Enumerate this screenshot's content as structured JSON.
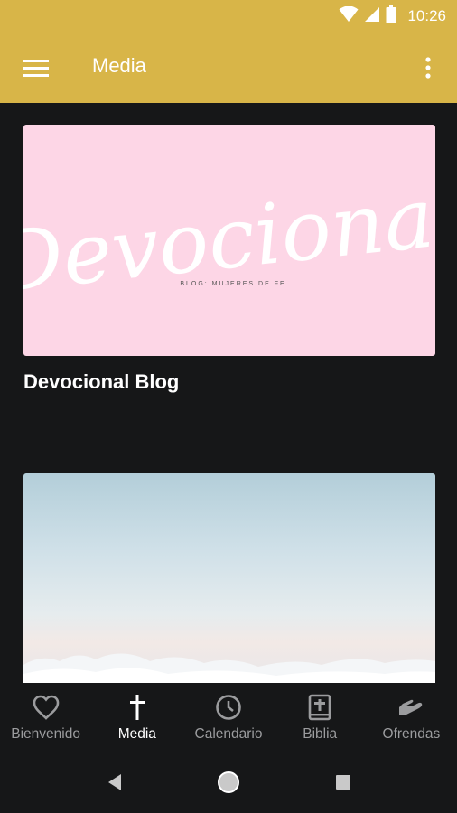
{
  "status_bar": {
    "time": "10:26",
    "icons": [
      "wifi-icon",
      "cell-signal-icon",
      "battery-icon"
    ]
  },
  "app_bar": {
    "title": "Media",
    "menu_icon": "hamburger-menu-icon",
    "overflow_icon": "more-vertical-icon",
    "color": "#d8b548"
  },
  "cards": [
    {
      "title": "Devocional Blog",
      "image_text": "Devocional",
      "image_subtitle": "BLOG: MUJERES DE FE",
      "image_bg": "#fdd6e6"
    },
    {
      "title": "",
      "image": "sky-clouds-image"
    }
  ],
  "bottom_nav": {
    "items": [
      {
        "label": "Bienvenido",
        "icon": "heart-icon",
        "active": false
      },
      {
        "label": "Media",
        "icon": "cross-icon",
        "active": true
      },
      {
        "label": "Calendario",
        "icon": "clock-icon",
        "active": false
      },
      {
        "label": "Biblia",
        "icon": "bible-icon",
        "active": false
      },
      {
        "label": "Ofrendas",
        "icon": "giving-hand-icon",
        "active": false
      }
    ]
  },
  "system_nav": [
    "back-icon",
    "home-icon",
    "recents-icon"
  ],
  "colors": {
    "accent": "#d8b548",
    "background": "#161718",
    "inactive": "#9b9c9e"
  }
}
